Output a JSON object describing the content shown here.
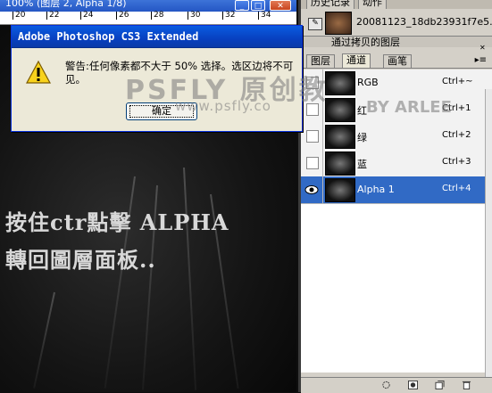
{
  "document": {
    "title": "100% (图层 2, Alpha 1/8)",
    "ruler_ticks": [
      "20",
      "22",
      "24",
      "26",
      "28",
      "30",
      "32",
      "34"
    ],
    "annotation_line1": "按住ctr點擊 ALPHA",
    "annotation_line2": "轉回圖層面板.."
  },
  "dialog": {
    "title": "Adobe Photoshop CS3 Extended",
    "message": "警告:任何像素都不大于 50% 选择。选区边将不可见。",
    "ok_label": "确定",
    "icon": "warning-icon"
  },
  "watermark": {
    "line1": "PSFLY 原创教",
    "line2": "www.psfly.co",
    "line3": "BY ARLEE"
  },
  "history": {
    "tabs": [
      "历史记录",
      "动作"
    ],
    "snapshot_label": "20081123_18db23931f7e5...",
    "partial_row": "通过拷贝的图层"
  },
  "channels_panel": {
    "tabs": [
      "图层",
      "通道",
      "画笔"
    ],
    "active_tab": "通道",
    "channels": [
      {
        "name": "RGB",
        "shortcut": "Ctrl+~",
        "visible": false,
        "selected": false
      },
      {
        "name": "红",
        "shortcut": "Ctrl+1",
        "visible": false,
        "selected": false
      },
      {
        "name": "绿",
        "shortcut": "Ctrl+2",
        "visible": false,
        "selected": false
      },
      {
        "name": "蓝",
        "shortcut": "Ctrl+3",
        "visible": false,
        "selected": false
      },
      {
        "name": "Alpha 1",
        "shortcut": "Ctrl+4",
        "visible": true,
        "selected": true
      }
    ],
    "footer_icons": [
      "load-selection-icon",
      "save-selection-icon",
      "new-channel-icon",
      "delete-channel-icon"
    ]
  },
  "colors": {
    "titlebar": "#0a5ce0",
    "selection": "#316ac5",
    "panel_bg": "#d4d0c8"
  }
}
